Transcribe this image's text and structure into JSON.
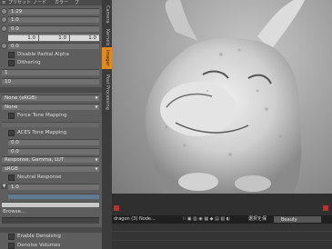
{
  "top_tabs": [
    "プリセット",
    "ノード",
    "カラー",
    "ブ"
  ],
  "fields": {
    "value_1": "1.29",
    "value_2": "1.0",
    "value_3": "0.0",
    "vec_x": "1.0",
    "vec_y": "1.0",
    "vec_z": "1.0",
    "value_4": "0.0",
    "dithering_value_1": "1",
    "dithering_value_2": "10",
    "response_value": "1.0",
    "browse_value": "",
    "aces_value_1": "0.0",
    "aces_value_2": "0.0",
    "neutral_value": "1.0"
  },
  "labels": {
    "disable_partial_alpha": "Disable Partial Alpha",
    "dithering": "Dithering",
    "none_srgb": "None (sRGB)",
    "none": "None",
    "force_tone_mapping": "Force Tone Mapping",
    "aces_tone_mapping": "ACES Tone Mapping",
    "response_gamma_lut": "Response, Gamma, LUT",
    "srgb": "sRGB",
    "neutral_response": "Neutral Response",
    "browse": "Browse...",
    "enable_denoising": "Enable Denoising",
    "denoise_volumes": "Denoise Volumes"
  },
  "side_tabs": [
    "Camera",
    "Kernels",
    "Imager",
    "Post Processing"
  ],
  "active_side_tab": "Imager",
  "nodebar": {
    "node_label": "dragon (3) Node...",
    "select_label": "選択を保",
    "render_pass": "Beauty"
  },
  "colors": {
    "accent": "#e08a21",
    "panel_bg": "#5e5e5e",
    "field_bg": "#717171"
  }
}
